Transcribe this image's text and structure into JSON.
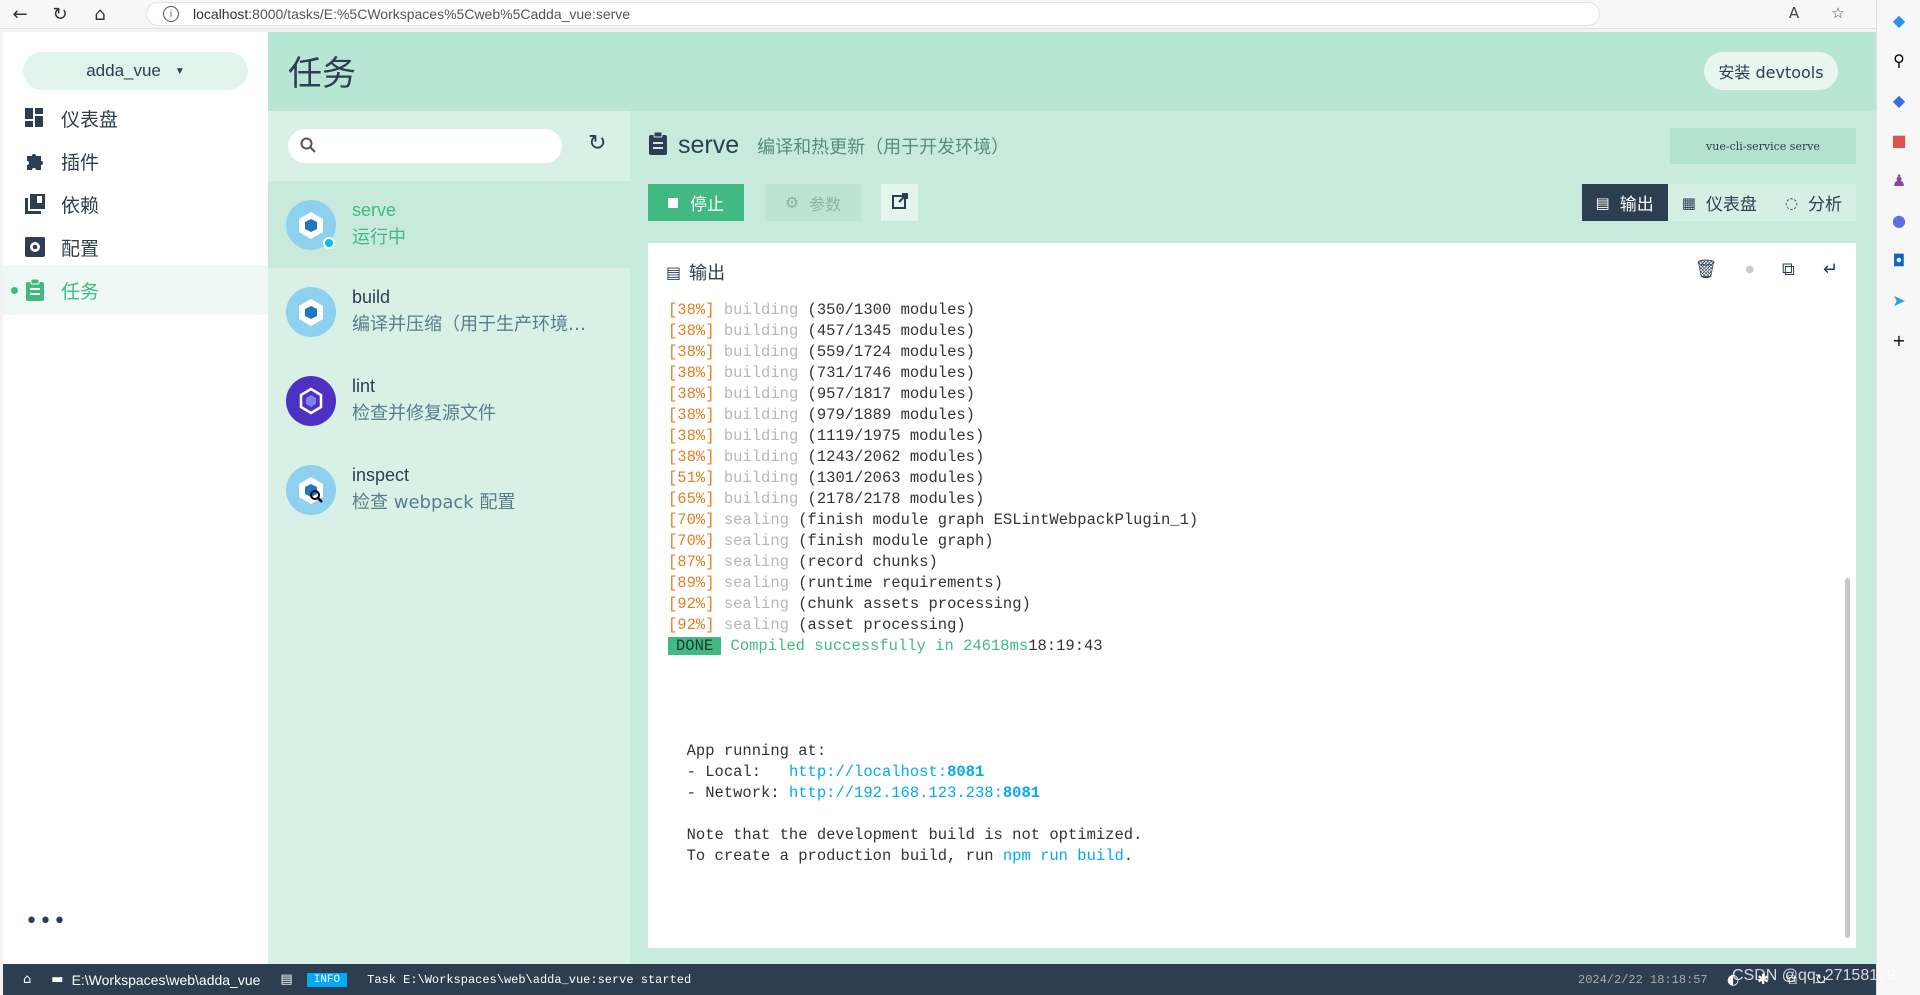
{
  "browser": {
    "url_host": "localhost",
    "url_rest": ":8000/tasks/E:%5CWorkspaces%5Cweb%5Cadda_vue:serve"
  },
  "app": {
    "project_name": "adda_vue",
    "nav": [
      {
        "label": "仪表盘",
        "icon": "dashboard-icon"
      },
      {
        "label": "插件",
        "icon": "puzzle-icon"
      },
      {
        "label": "依赖",
        "icon": "library-icon"
      },
      {
        "label": "配置",
        "icon": "settings-icon"
      },
      {
        "label": "任务",
        "icon": "clipboard-icon"
      }
    ],
    "more": "•••"
  },
  "header": {
    "title": "任务",
    "devtools_label": "安装 devtools"
  },
  "tasks": [
    {
      "name": "serve",
      "desc": "运行中"
    },
    {
      "name": "build",
      "desc": "编译并压缩（用于生产环境…"
    },
    {
      "name": "lint",
      "desc": "检查并修复源文件"
    },
    {
      "name": "inspect",
      "desc": "检查 webpack 配置"
    }
  ],
  "detail": {
    "name": "serve",
    "desc": "编译和热更新（用于开发环境）",
    "command": "vue-cli-service serve",
    "stop_label": "停止",
    "params_label": "参数",
    "tabs": [
      {
        "label": "输出",
        "icon": "terminal-icon"
      },
      {
        "label": "仪表盘",
        "icon": "dashboard-icon"
      },
      {
        "label": "分析",
        "icon": "analyzer-icon"
      }
    ]
  },
  "output": {
    "title": "输出",
    "log": [
      {
        "pct": "[38%]",
        "stage": "building",
        "text": " (350/1300 modules)"
      },
      {
        "pct": "[38%]",
        "stage": "building",
        "text": " (457/1345 modules)"
      },
      {
        "pct": "[38%]",
        "stage": "building",
        "text": " (559/1724 modules)"
      },
      {
        "pct": "[38%]",
        "stage": "building",
        "text": " (731/1746 modules)"
      },
      {
        "pct": "[38%]",
        "stage": "building",
        "text": " (957/1817 modules)"
      },
      {
        "pct": "[38%]",
        "stage": "building",
        "text": " (979/1889 modules)"
      },
      {
        "pct": "[38%]",
        "stage": "building",
        "text": " (1119/1975 modules)"
      },
      {
        "pct": "[38%]",
        "stage": "building",
        "text": " (1243/2062 modules)"
      },
      {
        "pct": "[51%]",
        "stage": "building",
        "text": " (1301/2063 modules)"
      },
      {
        "pct": "[65%]",
        "stage": "building",
        "text": " (2178/2178 modules)"
      },
      {
        "pct": "[70%]",
        "stage": "sealing",
        "text": " (finish module graph ESLintWebpackPlugin_1)"
      },
      {
        "pct": "[70%]",
        "stage": "sealing",
        "text": " (finish module graph)"
      },
      {
        "pct": "[87%]",
        "stage": "sealing",
        "text": " (record chunks)"
      },
      {
        "pct": "[89%]",
        "stage": "sealing",
        "text": " (runtime requirements)"
      },
      {
        "pct": "[92%]",
        "stage": "sealing",
        "text": " (chunk assets processing)"
      },
      {
        "pct": "[92%]",
        "stage": "sealing",
        "text": " (asset processing)"
      }
    ],
    "done_badge": "DONE",
    "done_text": "Compiled successfully in 24618ms",
    "done_time": "18:19:43",
    "running_at": "App running at:",
    "local_label": "- Local:   ",
    "local_url": "http://localhost:",
    "local_port": "8081",
    "network_label": "- Network: ",
    "network_url": "http://192.168.123.238:",
    "network_port": "8081",
    "note1": "Note that the development build is not optimized.",
    "note2_pre": "To create a production build, run ",
    "note2_cmd": "npm run build",
    "note2_post": "."
  },
  "statusbar": {
    "path": "E:\\Workspaces\\web\\adda_vue",
    "badge": "INFO",
    "message": "Task E:\\Workspaces\\web\\adda_vue:serve started",
    "date": "2024/2/22 18:18:57",
    "watermark": "CSDN @qq_27158179"
  }
}
